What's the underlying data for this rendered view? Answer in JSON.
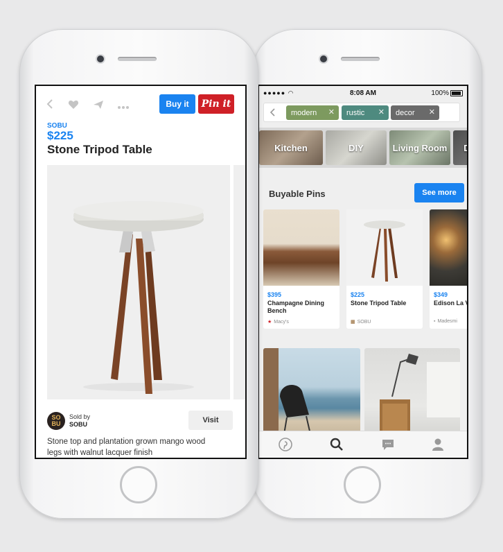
{
  "left_screen": {
    "buy_label": "Buy it",
    "pin_label": "Pin it",
    "brand": "SOBU",
    "price": "$225",
    "title": "Stone Tripod Table",
    "seller_avatar_text": "SO BU",
    "sold_by_label": "Sold by",
    "seller_name": "SOBU",
    "visit_label": "Visit",
    "description": "Stone top and plantation grown mango wood legs with walnut lacquer finish",
    "icons": [
      "back-icon",
      "heart-icon",
      "send-icon",
      "more-icon"
    ]
  },
  "right_screen": {
    "status": {
      "time": "8:08 AM",
      "battery": "100%"
    },
    "chips": [
      {
        "label": "modern",
        "color": "#7d9a5f"
      },
      {
        "label": "rustic",
        "color": "#4e8a7f"
      },
      {
        "label": "decor",
        "color": "#6a6a6a"
      }
    ],
    "categories": [
      "Kitchen",
      "DIY",
      "Living Room",
      "D"
    ],
    "section_title": "Buyable Pins",
    "see_more_label": "See more",
    "pins": [
      {
        "price": "$395",
        "title": "Champagne Dining Bench",
        "source": "Macy's"
      },
      {
        "price": "$225",
        "title": "Stone Tripod Table",
        "source": "SOBU"
      },
      {
        "price": "$349",
        "title": "Edison La Vertical",
        "source": "Madesmi"
      }
    ],
    "tabs": [
      "pinterest-logo-icon",
      "search-icon",
      "messages-icon",
      "profile-icon"
    ]
  },
  "colors": {
    "accent_blue": "#1a83f0",
    "pin_red": "#cf2027"
  }
}
